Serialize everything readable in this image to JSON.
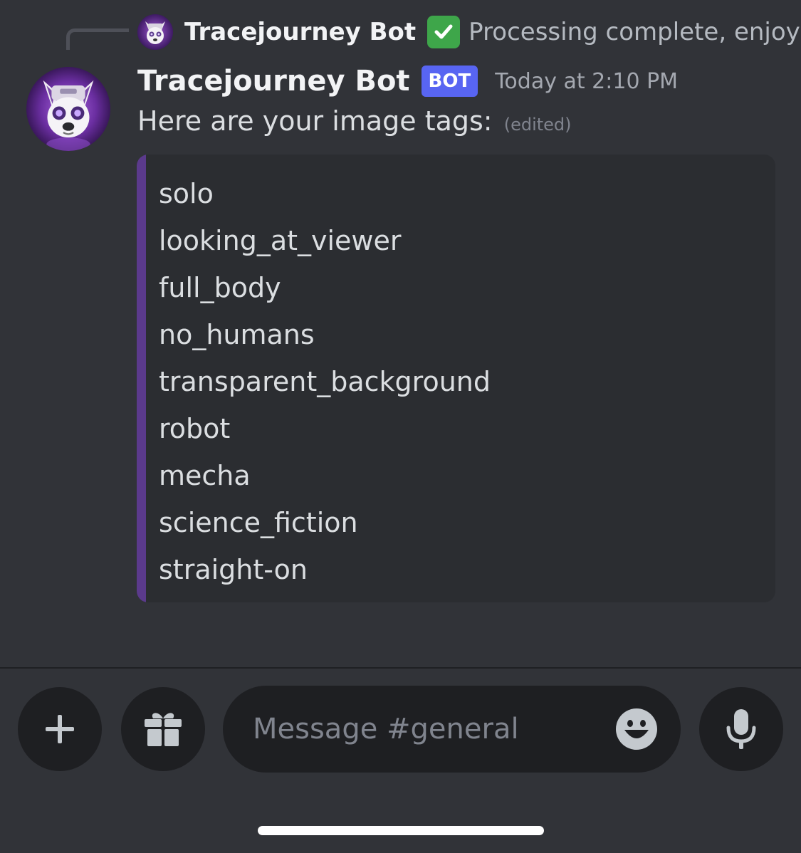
{
  "reply": {
    "author": "Tracejourney Bot",
    "emoji": "✅",
    "text": "Processing complete, enjoy!"
  },
  "message": {
    "author": "Tracejourney Bot",
    "bot_tag": "BOT",
    "timestamp": "Today at 2:10 PM",
    "body": "Here are your image tags:",
    "edited": "(edited)",
    "avatar_icon": "robot-dog-avatar"
  },
  "embed": {
    "accent_color": "#5b3a8c",
    "tags": [
      "solo",
      "looking_at_viewer",
      "full_body",
      "no_humans",
      "transparent_background",
      "robot",
      "mecha",
      "science_fiction",
      "straight-on"
    ]
  },
  "composer": {
    "placeholder": "Message #general",
    "value": "",
    "plus_icon": "plus-icon",
    "gift_icon": "gift-icon",
    "emoji_icon": "emoji-smile-icon",
    "mic_icon": "microphone-icon"
  },
  "colors": {
    "background": "#313338",
    "bot_tag": "#5865f2",
    "input_bg": "#1e1f22",
    "embed_bg": "#2b2d31"
  }
}
